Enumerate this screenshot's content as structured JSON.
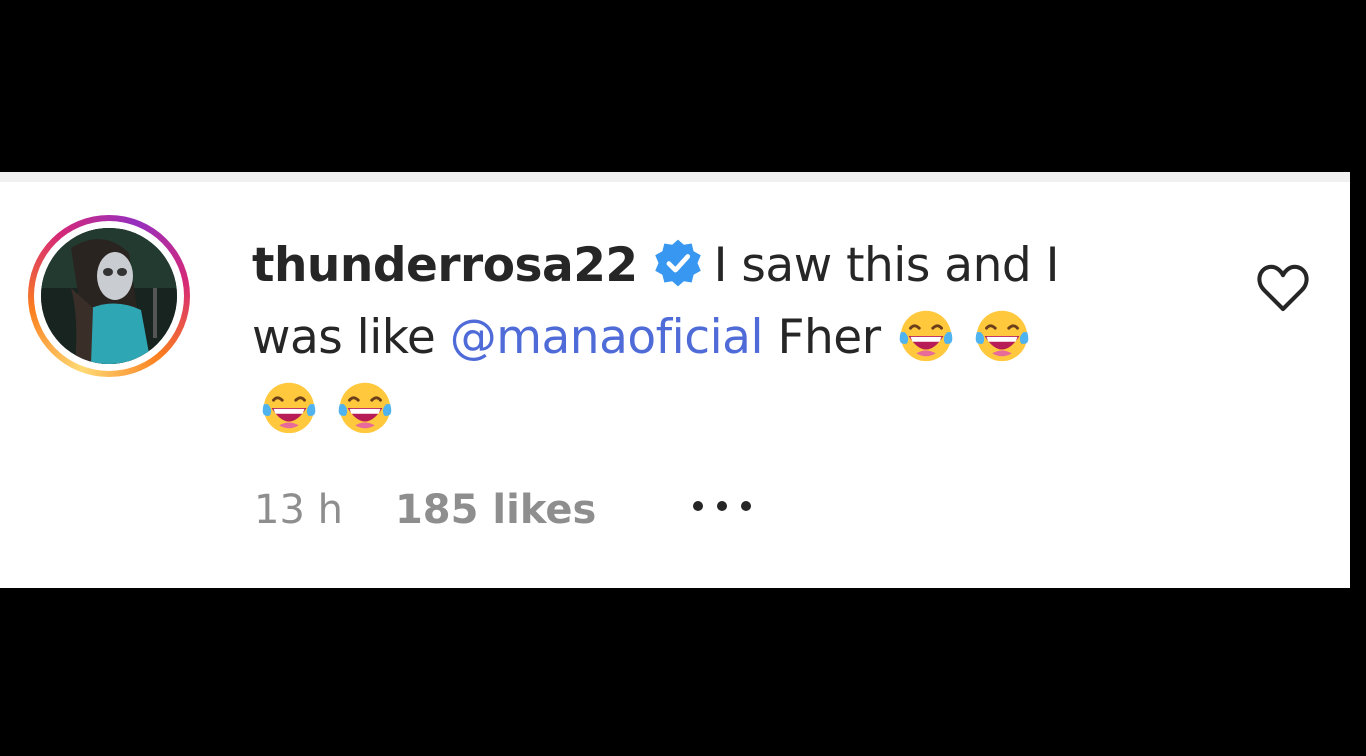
{
  "comment": {
    "username": "thunderrosa22",
    "verified_icon": "verified-badge-icon",
    "text_part1": "I saw this and I was like",
    "mention": "@manaoficial",
    "text_part2": "Fher",
    "emoji_icon": "face-with-tears-of-joy-icon",
    "emoji_count": 4,
    "time": "13 h",
    "likes": "185 likes",
    "more_icon": "more-options-icon",
    "like_icon": "heart-outline-icon"
  },
  "colors": {
    "background": "#000000",
    "card": "#ffffff",
    "text": "#262626",
    "meta": "#8e8e8e",
    "mention": "#4f6bd8",
    "verified": "#3897f0"
  }
}
